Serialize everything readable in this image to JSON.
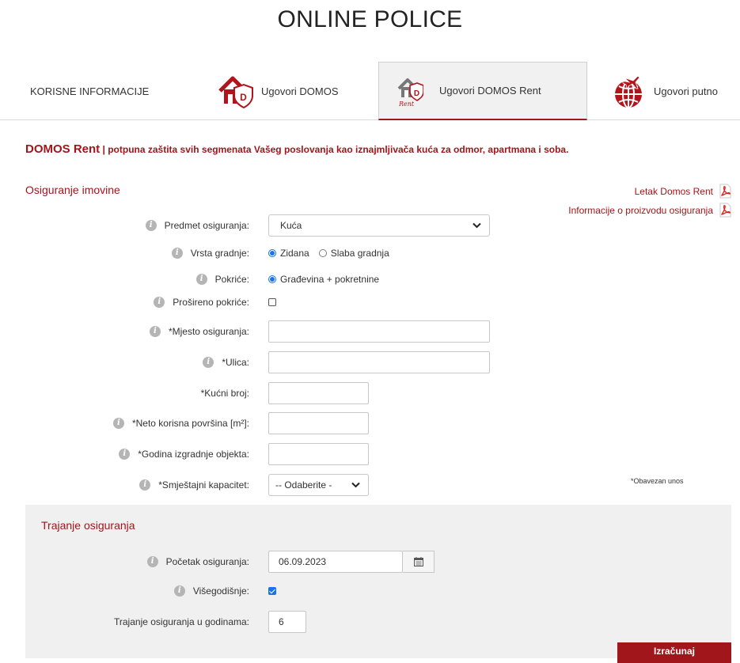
{
  "page_title": "ONLINE POLICE",
  "tabs": [
    {
      "label": "KORISNE INFORMACIJE",
      "icon": ""
    },
    {
      "label": "Ugovori DOMOS",
      "icon": "house-shield-icon"
    },
    {
      "label": "Ugovori DOMOS Rent",
      "icon": "house-rent-icon",
      "active": true
    },
    {
      "label": "Ugovori putno",
      "icon": "globe-plane-icon"
    }
  ],
  "tagline": {
    "brand": "DOMOS Rent",
    "separator": "|",
    "text": "potpuna zaštita svih segmenata Vašeg poslovanja kao iznajmljivača kuća za odmor, apartmana i soba."
  },
  "property_section": {
    "title": "Osiguranje imovine",
    "links": [
      {
        "label": "Letak Domos Rent",
        "icon": "pdf-icon"
      },
      {
        "label": "Informacije o proizvodu osiguranja",
        "icon": "pdf-icon"
      }
    ],
    "subject": {
      "label": "Predmet osiguranja:",
      "value": "Kuća"
    },
    "construction": {
      "label": "Vrsta gradnje:",
      "options": [
        {
          "label": "Zidana",
          "selected": true
        },
        {
          "label": "Slaba gradnja",
          "selected": false
        }
      ]
    },
    "coverage": {
      "label": "Pokriće:",
      "option": "Građevina + pokretnine"
    },
    "extended": {
      "label": "Prošireno pokriće:",
      "checked": false
    },
    "place": {
      "label": "*Mjesto osiguranja:",
      "value": ""
    },
    "street": {
      "label": "*Ulica:",
      "value": ""
    },
    "house_number": {
      "label": "*Kućni broj:",
      "value": ""
    },
    "area": {
      "label": "*Neto korisna površina [m²]:",
      "value": ""
    },
    "year_built": {
      "label": "*Godina izgradnje objekta:",
      "value": ""
    },
    "capacity": {
      "label": "*Smještajni kapacitet:",
      "value": "-- Odaberite -"
    },
    "required_note": "*Obavezan unos"
  },
  "duration_section": {
    "title": "Trajanje osiguranja",
    "start": {
      "label": "Početak osiguranja:",
      "value": "06.09.2023"
    },
    "multiyear": {
      "label": "Višegodišnje:",
      "checked": true
    },
    "years": {
      "label": "Trajanje osiguranja u godinama:",
      "value": "6"
    }
  },
  "calculate_button": "Izračunaj",
  "colors": {
    "accent": "#a1161a",
    "panel": "#f0f0f0",
    "radio": "#1a73e8"
  }
}
